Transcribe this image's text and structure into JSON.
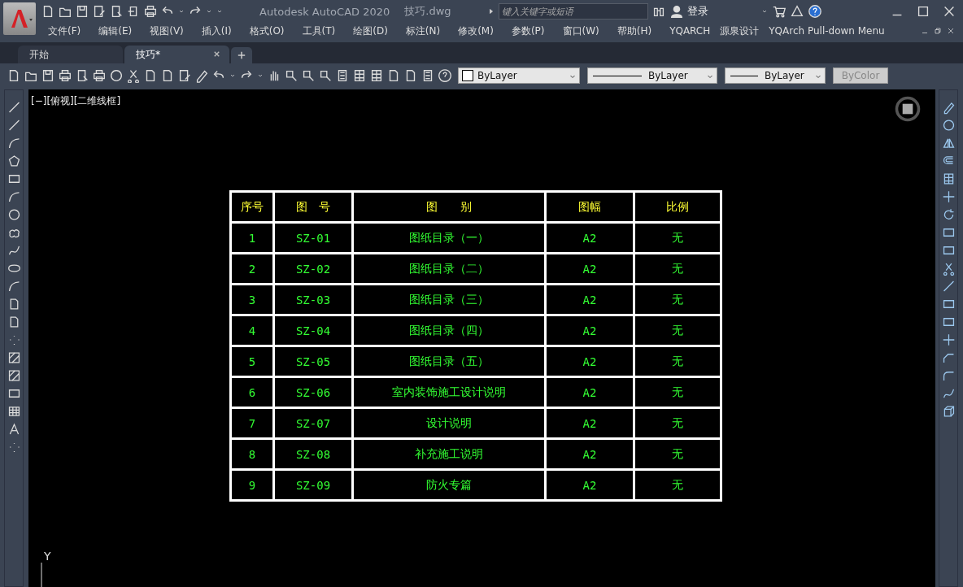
{
  "title_bar": {
    "app_title": "Autodesk AutoCAD 2020",
    "file_name": "技巧.dwg",
    "search": {
      "placeholder": "键入关键字或短语"
    },
    "login": "登录"
  },
  "menu": [
    "文件(F)",
    "编辑(E)",
    "视图(V)",
    "插入(I)",
    "格式(O)",
    "工具(T)",
    "绘图(D)",
    "标注(N)",
    "修改(M)",
    "参数(P)",
    "窗口(W)",
    "帮助(H)",
    "YQARCH",
    "源泉设计",
    "YQArch Pull-down Menu"
  ],
  "tabs": [
    {
      "label": "开始",
      "selected": false
    },
    {
      "label": "技巧*",
      "selected": true
    }
  ],
  "properties": {
    "color_control": "ByLayer",
    "linetype": "ByLayer",
    "lineweight": "ByLayer",
    "plot_style": "ByColor"
  },
  "viewport_label": "[−][俯视][二维线框]",
  "table": {
    "columns": [
      "序号",
      "图　号",
      "图　　别",
      "图幅",
      "比例"
    ],
    "rows": [
      [
        "1",
        "SZ-01",
        "图纸目录（一）",
        "A2",
        "无"
      ],
      [
        "2",
        "SZ-02",
        "图纸目录（二）",
        "A2",
        "无"
      ],
      [
        "3",
        "SZ-03",
        "图纸目录（三）",
        "A2",
        "无"
      ],
      [
        "4",
        "SZ-04",
        "图纸目录（四）",
        "A2",
        "无"
      ],
      [
        "5",
        "SZ-05",
        "图纸目录（五）",
        "A2",
        "无"
      ],
      [
        "6",
        "SZ-06",
        "室内装饰施工设计说明",
        "A2",
        "无"
      ],
      [
        "7",
        "SZ-07",
        "设计说明",
        "A2",
        "无"
      ],
      [
        "8",
        "SZ-08",
        "补充施工说明",
        "A2",
        "无"
      ],
      [
        "9",
        "SZ-09",
        "防火专篇",
        "A2",
        "无"
      ]
    ]
  },
  "axis_label": "Y"
}
